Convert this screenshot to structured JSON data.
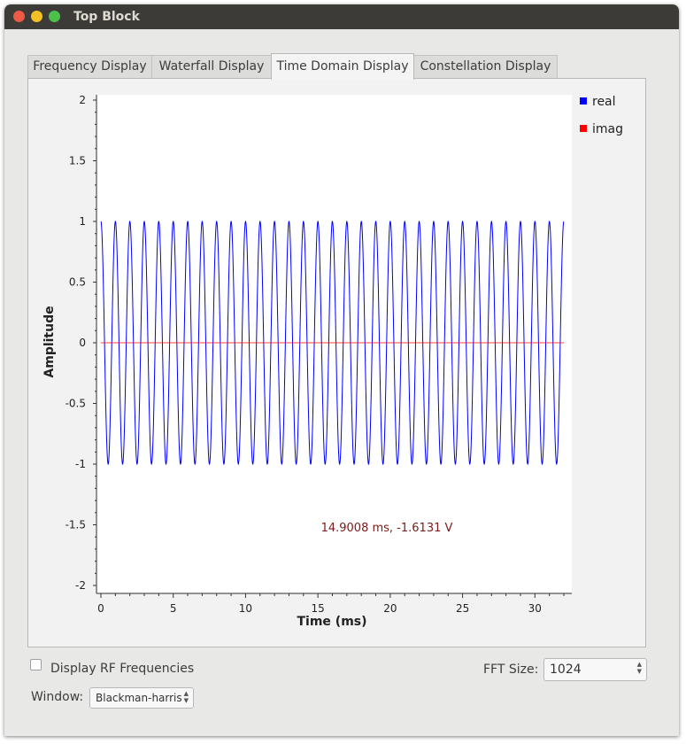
{
  "window": {
    "title": "Top Block"
  },
  "tabs": [
    {
      "label": "Frequency Display",
      "active": false
    },
    {
      "label": "Waterfall Display",
      "active": false
    },
    {
      "label": "Time Domain Display",
      "active": true
    },
    {
      "label": "Constellation Display",
      "active": false
    }
  ],
  "chart_data": {
    "type": "line",
    "xlabel": "Time (ms)",
    "ylabel": "Amplitude",
    "xlim": [
      0,
      32
    ],
    "ylim": [
      -2,
      2
    ],
    "xticks": [
      "0",
      "5",
      "10",
      "15",
      "20",
      "25",
      "30"
    ],
    "yticks": [
      "2",
      "1.5",
      "1",
      "0.5",
      "0",
      "-0.5",
      "-1",
      "-1.5",
      "-2"
    ],
    "series": [
      {
        "name": "real",
        "color": "#0000ff",
        "kind": "cosine",
        "amplitude": 1,
        "period_ms": 1.0,
        "x_start": 0,
        "x_end": 32
      },
      {
        "name": "imag",
        "color": "#ff0000",
        "kind": "constant",
        "value": 0,
        "x_start": 0,
        "x_end": 32
      }
    ],
    "legend": "right",
    "annotation": "14.9008 ms, -1.6131 V",
    "annotation_color": "#7a1a1a"
  },
  "controls": {
    "display_rf_label": "Display RF Frequencies",
    "display_rf_checked": false,
    "fft_size_label": "FFT Size:",
    "fft_size_value": "1024",
    "window_label": "Window:",
    "window_value": "Blackman-harris"
  }
}
